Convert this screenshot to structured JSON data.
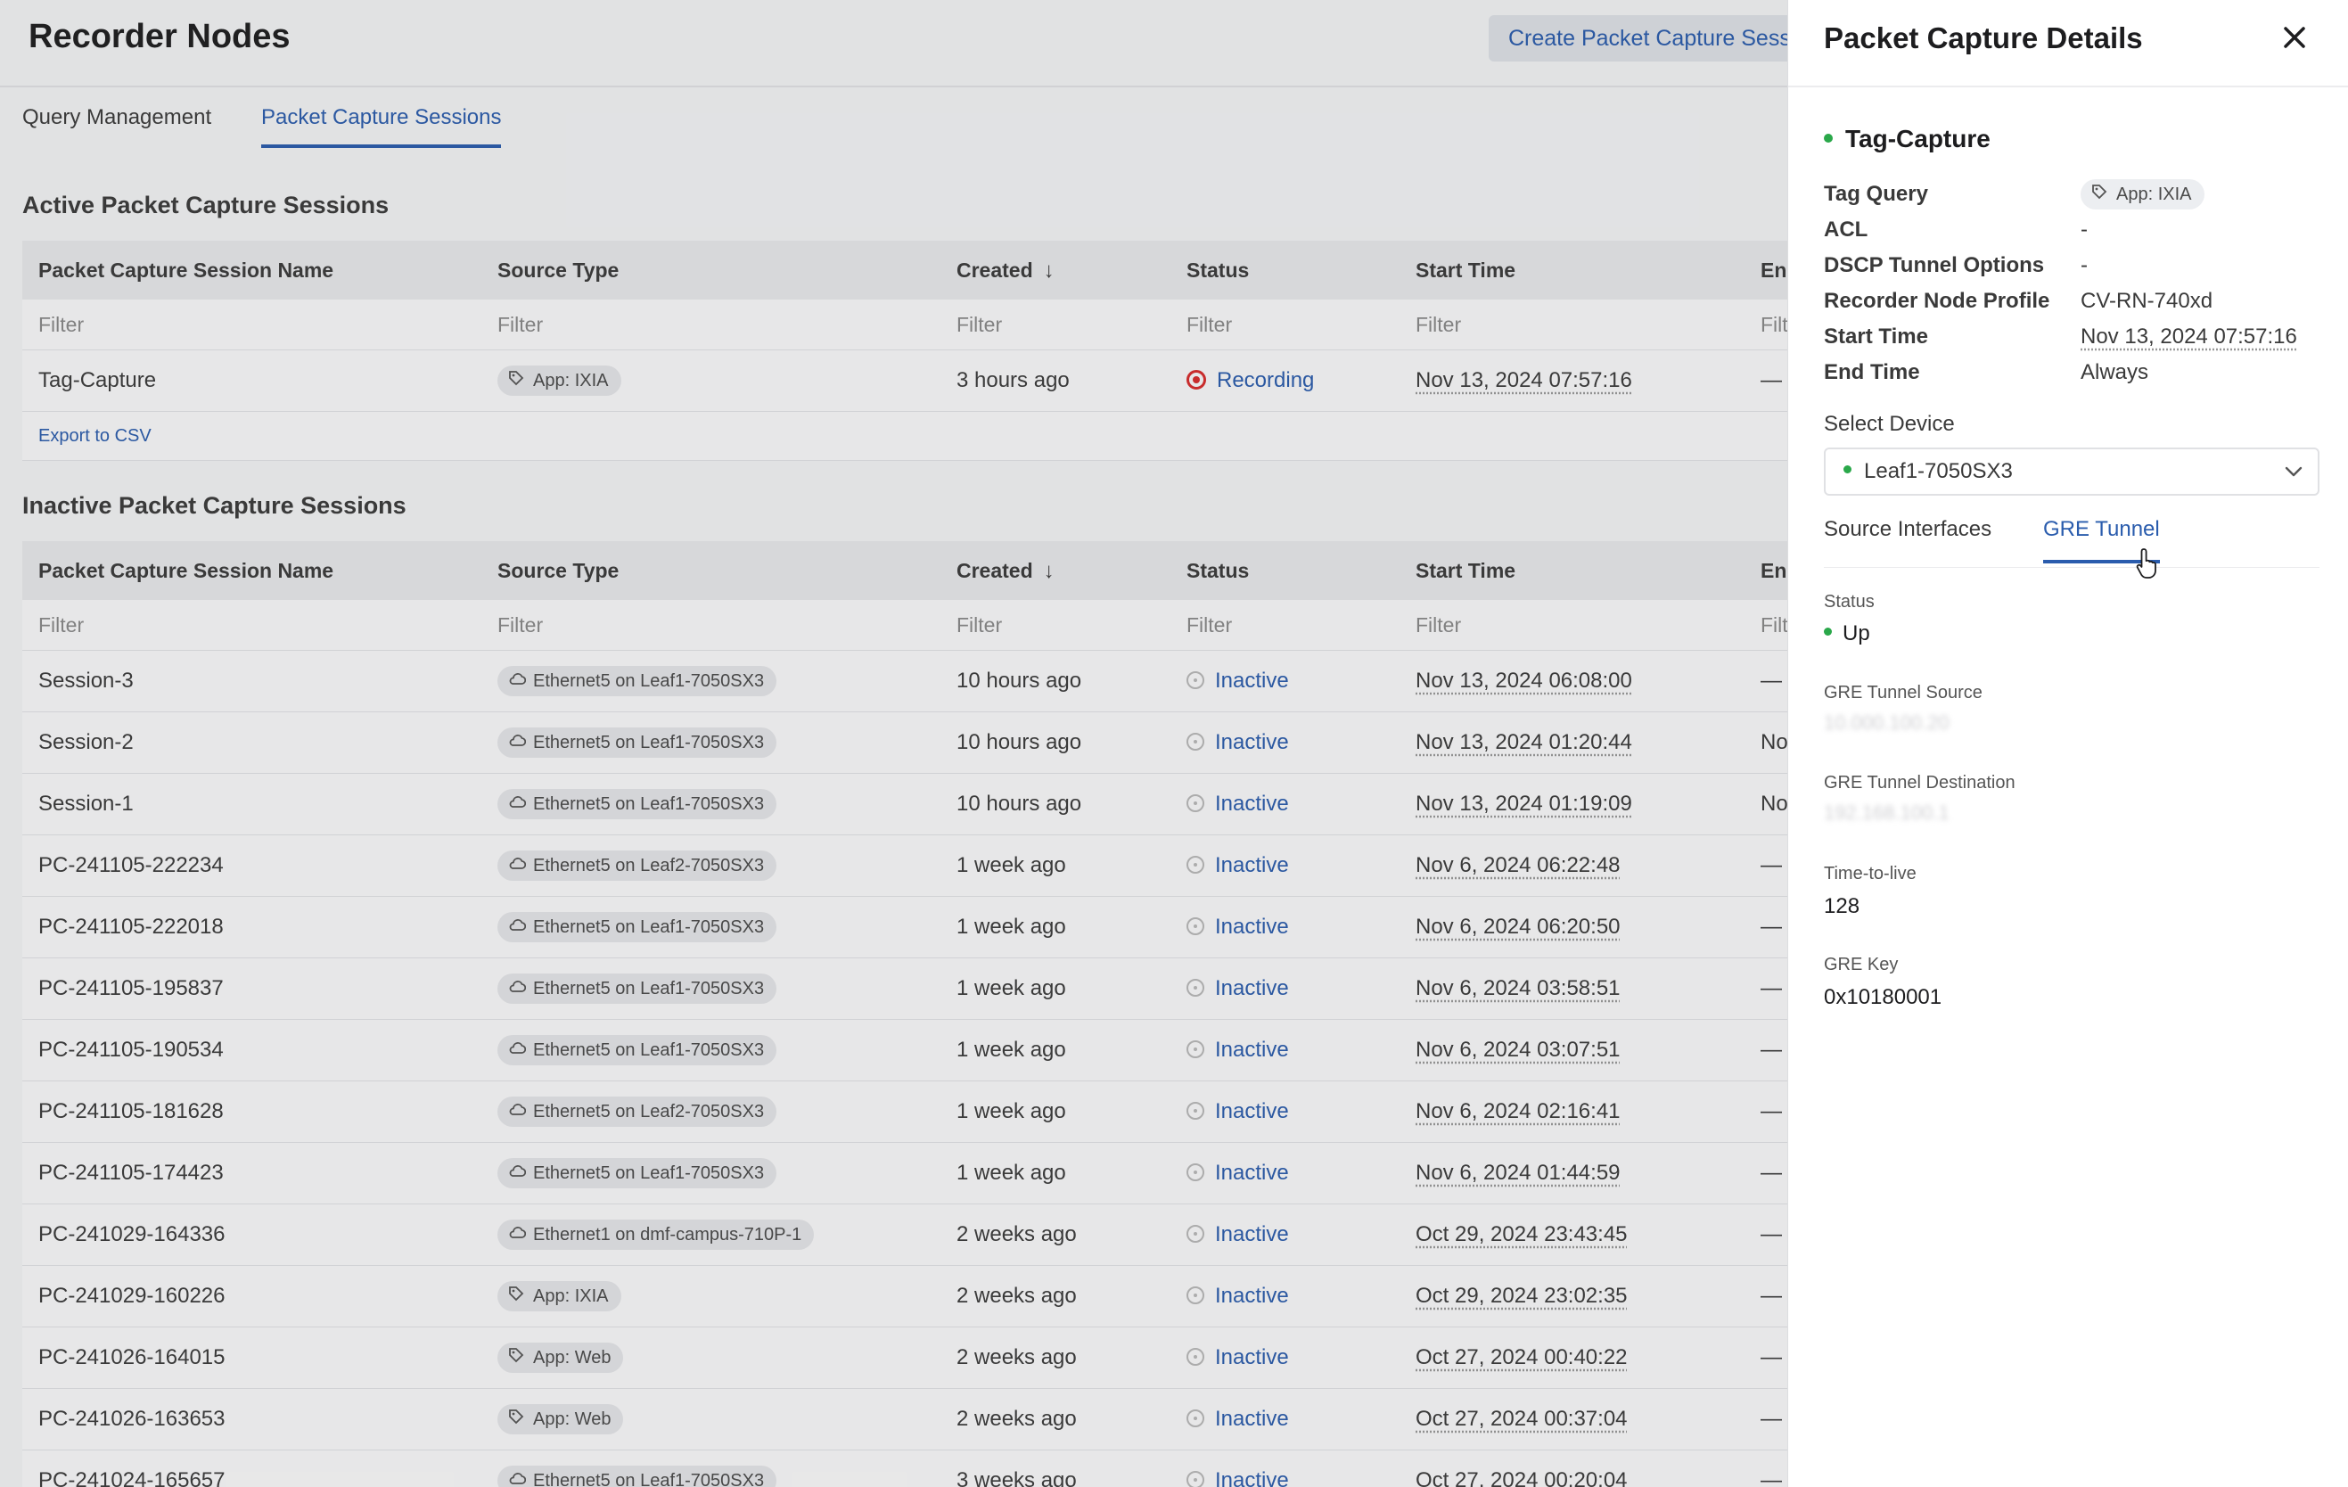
{
  "page": {
    "title": "Recorder Nodes",
    "create_button": "Create Packet Capture Session"
  },
  "tabs": [
    "Query Management",
    "Packet Capture Sessions"
  ],
  "active_section": {
    "title": "Active Packet Capture Sessions",
    "columns": [
      "Packet Capture Session Name",
      "Source Type",
      "Created",
      "Status",
      "Start Time",
      "End Time"
    ],
    "filter_placeholder": "Filter",
    "rows": [
      {
        "name": "Tag-Capture",
        "source": "App: IXIA",
        "source_kind": "tag-icon",
        "created": "3 hours ago",
        "status": "Recording",
        "start": "Nov 13, 2024 07:57:16",
        "end": "—"
      }
    ],
    "export": "Export to CSV"
  },
  "inactive_section": {
    "title": "Inactive Packet Capture Sessions",
    "columns": [
      "Packet Capture Session Name",
      "Source Type",
      "Created",
      "Status",
      "Start Time",
      "End Time"
    ],
    "filter_placeholder": "Filter",
    "rows": [
      {
        "name": "Session-3",
        "source": "Ethernet5 on Leaf1-7050SX3",
        "source_kind": "cloud-icon",
        "created": "10 hours ago",
        "status": "Inactive",
        "start": "Nov 13, 2024 06:08:00",
        "end": "—"
      },
      {
        "name": "Session-2",
        "source": "Ethernet5 on Leaf1-7050SX3",
        "source_kind": "cloud-icon",
        "created": "10 hours ago",
        "status": "Inactive",
        "start": "Nov 13, 2024 01:20:44",
        "end": "No"
      },
      {
        "name": "Session-1",
        "source": "Ethernet5 on Leaf1-7050SX3",
        "source_kind": "cloud-icon",
        "created": "10 hours ago",
        "status": "Inactive",
        "start": "Nov 13, 2024 01:19:09",
        "end": "No"
      },
      {
        "name": "PC-241105-222234",
        "source": "Ethernet5 on Leaf2-7050SX3",
        "source_kind": "cloud-icon",
        "created": "1 week ago",
        "status": "Inactive",
        "start": "Nov 6, 2024 06:22:48",
        "end": "—"
      },
      {
        "name": "PC-241105-222018",
        "source": "Ethernet5 on Leaf1-7050SX3",
        "source_kind": "cloud-icon",
        "created": "1 week ago",
        "status": "Inactive",
        "start": "Nov 6, 2024 06:20:50",
        "end": "—"
      },
      {
        "name": "PC-241105-195837",
        "source": "Ethernet5 on Leaf1-7050SX3",
        "source_kind": "cloud-icon",
        "created": "1 week ago",
        "status": "Inactive",
        "start": "Nov 6, 2024 03:58:51",
        "end": "—"
      },
      {
        "name": "PC-241105-190534",
        "source": "Ethernet5 on Leaf1-7050SX3",
        "source_kind": "cloud-icon",
        "created": "1 week ago",
        "status": "Inactive",
        "start": "Nov 6, 2024 03:07:51",
        "end": "—"
      },
      {
        "name": "PC-241105-181628",
        "source": "Ethernet5 on Leaf2-7050SX3",
        "source_kind": "cloud-icon",
        "created": "1 week ago",
        "status": "Inactive",
        "start": "Nov 6, 2024 02:16:41",
        "end": "—"
      },
      {
        "name": "PC-241105-174423",
        "source": "Ethernet5 on Leaf1-7050SX3",
        "source_kind": "cloud-icon",
        "created": "1 week ago",
        "status": "Inactive",
        "start": "Nov 6, 2024 01:44:59",
        "end": "—"
      },
      {
        "name": "PC-241029-164336",
        "source": "Ethernet1 on dmf-campus-710P-1",
        "source_kind": "cloud-icon",
        "created": "2 weeks ago",
        "status": "Inactive",
        "start": "Oct 29, 2024 23:43:45",
        "end": "—"
      },
      {
        "name": "PC-241029-160226",
        "source": "App: IXIA",
        "source_kind": "tag-icon",
        "created": "2 weeks ago",
        "status": "Inactive",
        "start": "Oct 29, 2024 23:02:35",
        "end": "—"
      },
      {
        "name": "PC-241026-164015",
        "source": "App: Web",
        "source_kind": "tag-icon",
        "created": "2 weeks ago",
        "status": "Inactive",
        "start": "Oct 27, 2024 00:40:22",
        "end": "—"
      },
      {
        "name": "PC-241026-163653",
        "source": "App: Web",
        "source_kind": "tag-icon",
        "created": "2 weeks ago",
        "status": "Inactive",
        "start": "Oct 27, 2024 00:37:04",
        "end": "—"
      },
      {
        "name": "PC-241024-165657",
        "source": "Ethernet5 on Leaf1-7050SX3",
        "source_kind": "cloud-icon",
        "created": "3 weeks ago",
        "status": "Inactive",
        "start": "Oct 27, 2024 00:20:04",
        "end": "—"
      }
    ]
  },
  "drawer": {
    "title": "Packet Capture Details",
    "session_name": "Tag-Capture",
    "details": [
      {
        "label": "Tag Query",
        "value": "App: IXIA"
      },
      {
        "label": "ACL",
        "value": "-"
      },
      {
        "label": "DSCP Tunnel Options",
        "value": "-"
      },
      {
        "label": "Recorder Node Profile",
        "value": "CV-RN-740xd"
      },
      {
        "label": "Start Time",
        "value": "Nov 13, 2024 07:57:16"
      },
      {
        "label": "End Time",
        "value": "Always"
      }
    ],
    "select_label": "Select Device",
    "selected_device": "Leaf1-7050SX3",
    "tabs": [
      "Source Interfaces",
      "GRE Tunnel"
    ],
    "gre": {
      "status_label": "Status",
      "status_value": "Up",
      "source_label": "GRE Tunnel Source",
      "source_value": "10.000.100.20",
      "dest_label": "GRE Tunnel Destination",
      "dest_value": "192.168.100.1",
      "ttl_label": "Time-to-live",
      "ttl_value": "128",
      "key_label": "GRE Key",
      "key_value": "0x10180001"
    }
  },
  "colors": {
    "accent": "#2a5cad",
    "recording": "#d92b2b",
    "up": "#2aa84a"
  }
}
